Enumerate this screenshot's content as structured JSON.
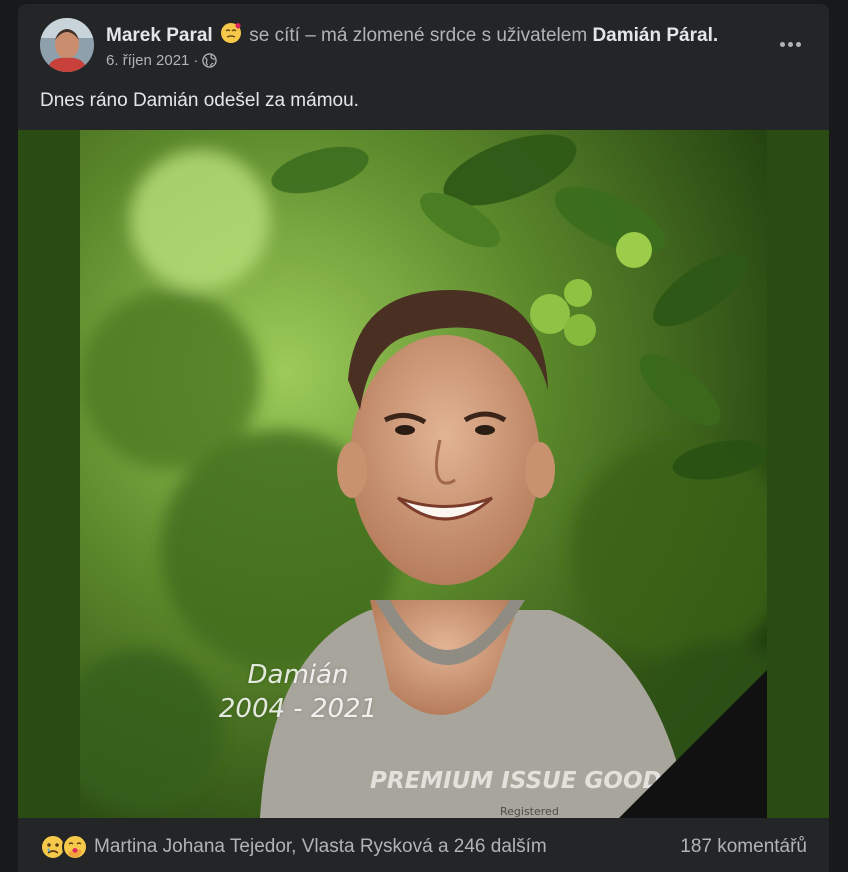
{
  "post": {
    "author": "Marek Paral",
    "feeling_text": "se cítí – má zlomené srdce s uživatelem",
    "tagged_user": "Damián Páral",
    "date": "6. říjen 2021",
    "separator": "·",
    "privacy_icon": "globe-icon",
    "more_icon": "more-options-icon",
    "feeling_icon": "broken-heart-face-emoji",
    "text": "Dnes ráno Damián odešel za mámou."
  },
  "photo": {
    "caption_name": "Damián",
    "caption_years": "2004 - 2021",
    "shirt_text": "PREMIUM ISSUE GOODS",
    "shirt_subtext": "Registered",
    "frame_color": "#2a4b14",
    "mourning_ribbon_color": "#111111"
  },
  "footer": {
    "reaction_icons": [
      "sad-emoji",
      "care-emoji"
    ],
    "reactions_text": "Martina Johana Tejedor, Vlasta Rysková a 246 dalším",
    "comments_text": "187 komentářů"
  }
}
